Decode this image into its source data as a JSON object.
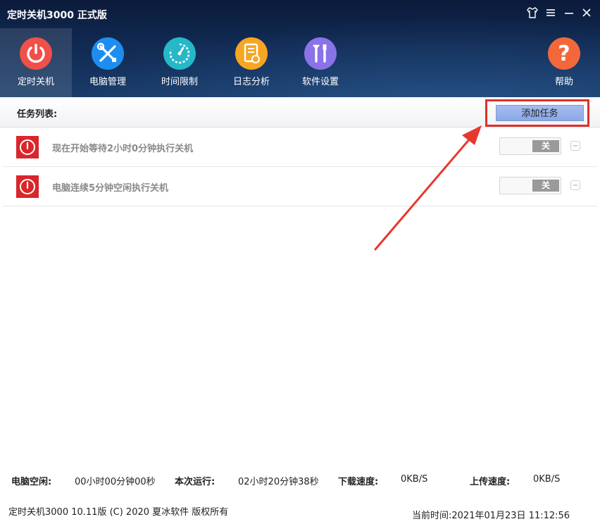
{
  "window": {
    "title": "定时关机3000 正式版"
  },
  "nav": {
    "items": [
      {
        "label": "定时关机",
        "icon": "power-icon",
        "color": "#f0504a"
      },
      {
        "label": "电脑管理",
        "icon": "tools-icon",
        "color": "#1d8ef0"
      },
      {
        "label": "时间限制",
        "icon": "timer-icon",
        "color": "#26b8c9"
      },
      {
        "label": "日志分析",
        "icon": "log-icon",
        "color": "#f5a623"
      },
      {
        "label": "软件设置",
        "icon": "wrench-screwdriver-icon",
        "color": "#8a72e8"
      }
    ],
    "help": {
      "label": "帮助",
      "icon": "help-icon",
      "color": "#f2683a"
    }
  },
  "toolbar": {
    "label": "任务列表:",
    "add_button": "添加任务"
  },
  "tasks": [
    {
      "text": "现在开始等待2小时0分钟执行关机",
      "toggle": "关"
    },
    {
      "text": "电脑连续5分钟空闲执行关机",
      "toggle": "关"
    }
  ],
  "stats": {
    "idle_label": "电脑空闲:",
    "idle_value": "00小时00分钟00秒",
    "run_label": "本次运行:",
    "run_value": "02小时20分钟38秒",
    "down_label": "下载速度:",
    "down_value": "0KB/S",
    "up_label": "上传速度:",
    "up_value": "0KB/S"
  },
  "footer": {
    "copyright": "定时关机3000 10.11版 (C) 2020 夏冰软件 版权所有",
    "time_label": "当前时间:",
    "time_value": "2021年01月23日 11:12:56"
  },
  "colors": {
    "highlight": "#e0302b",
    "arrow": "#e8382e",
    "task_icon": "#d9262b"
  }
}
